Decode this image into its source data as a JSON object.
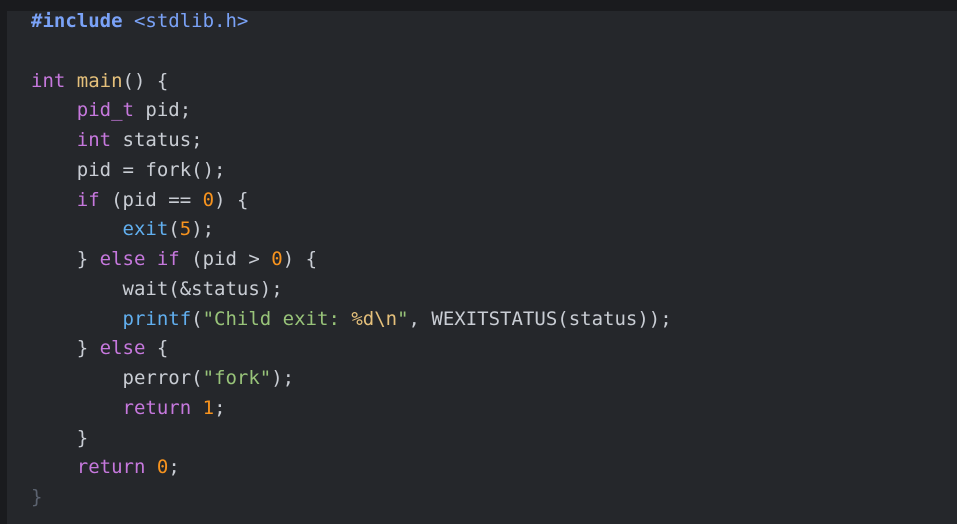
{
  "editor": {
    "lines": [
      {
        "t1": "#include",
        "t2": " <stdlib.h>"
      },
      {},
      {
        "kw": "int",
        "fn": "main",
        "rest": "() {"
      },
      {
        "indent": "    ",
        "ty": "pid_t",
        "rest": " pid;"
      },
      {
        "indent": "    ",
        "ty": "int",
        "rest": " status;"
      },
      {
        "indent": "    ",
        "rest": "pid = fork();"
      },
      {
        "indent": "    ",
        "kw": "if",
        "a": " (pid == ",
        "num": "0",
        "b": ") {"
      },
      {
        "indent": "        ",
        "call": "exit",
        "a": "(",
        "num": "5",
        "b": ");"
      },
      {
        "indent": "    ",
        "a": "} ",
        "kw": "else if",
        "b": " (pid > ",
        "num": "0",
        "c": ") {"
      },
      {
        "indent": "        ",
        "rest": "wait(&status);"
      },
      {
        "indent": "        ",
        "call": "printf",
        "a": "(",
        "str1": "\"Child exit: ",
        "fmt": "%d\\n",
        "str2": "\"",
        "b": ", WEXITSTATUS(status));"
      },
      {
        "indent": "    ",
        "a": "} ",
        "kw": "else",
        "b": " {"
      },
      {
        "indent": "        ",
        "rest": "perror(",
        "str": "\"fork\"",
        "b": ");"
      },
      {
        "indent": "        ",
        "kw": "return",
        "a": " ",
        "num": "1",
        "b": ";"
      },
      {
        "indent": "    ",
        "rest": "}"
      },
      {
        "indent": "    ",
        "kw": "return",
        "a": " ",
        "num": "0",
        "b": ";"
      },
      {
        "rest": "}"
      }
    ]
  },
  "colors": {
    "background": "#25272b",
    "keyword": "#c678dd",
    "function_def": "#e5c07b",
    "function_call": "#61afef",
    "number": "#f7931e",
    "string": "#98c379",
    "preprocessor": "#7aa2f7",
    "plain": "#c9cdd4"
  }
}
